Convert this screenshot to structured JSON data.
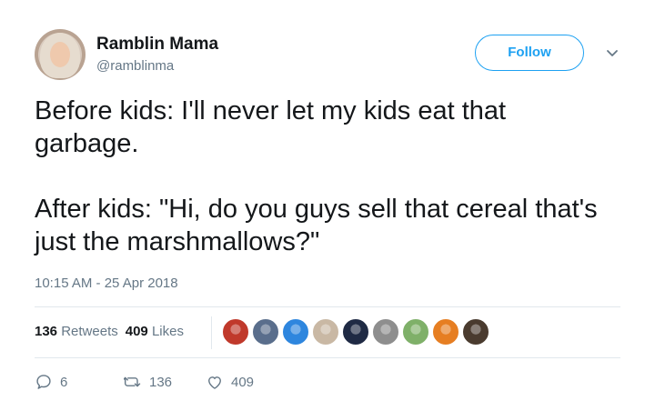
{
  "tweet": {
    "display_name": "Ramblin Mama",
    "handle": "@ramblinma",
    "follow_label": "Follow",
    "body": [
      "Before kids: I'll never let my kids eat that garbage.",
      "After kids: \"Hi, do you guys sell that cereal that's just the marshmallows?\""
    ],
    "timestamp": "10:15 AM - 25 Apr 2018"
  },
  "stats": {
    "retweets_count": "136",
    "retweets_label": "Retweets",
    "likes_count": "409",
    "likes_label": "Likes"
  },
  "actions": {
    "reply_count": "6",
    "retweet_count": "136",
    "like_count": "409"
  },
  "likers": [
    {
      "name": "liker-avatar-1",
      "color": "#c0392b"
    },
    {
      "name": "liker-avatar-2",
      "color": "#5a6e8c"
    },
    {
      "name": "liker-avatar-3",
      "color": "#2e86de"
    },
    {
      "name": "liker-avatar-4",
      "color": "#c9b8a4"
    },
    {
      "name": "liker-avatar-5",
      "color": "#1f2a44"
    },
    {
      "name": "liker-avatar-6",
      "color": "#8e8e8e"
    },
    {
      "name": "liker-avatar-7",
      "color": "#7fb069"
    },
    {
      "name": "liker-avatar-8",
      "color": "#e67e22"
    },
    {
      "name": "liker-avatar-9",
      "color": "#4a3b2f"
    }
  ],
  "colors": {
    "accent": "#1da1f2",
    "secondary_text": "#657786",
    "primary_text": "#14171a"
  }
}
